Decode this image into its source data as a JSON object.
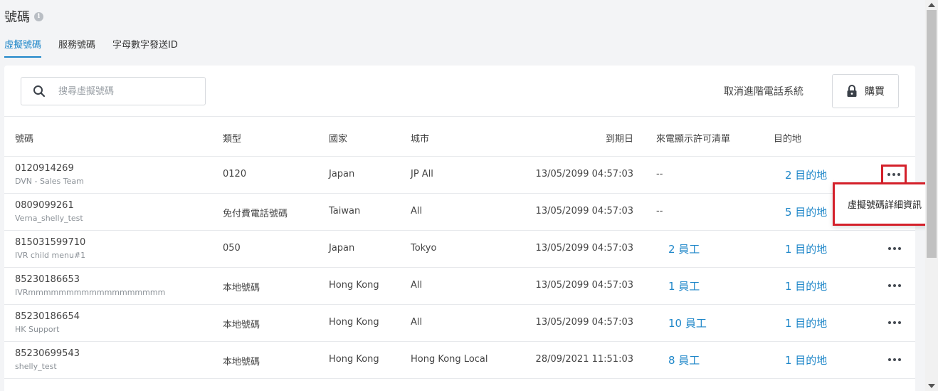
{
  "page": {
    "title": "號碼"
  },
  "tabs": [
    {
      "label": "虛擬號碼",
      "active": true
    },
    {
      "label": "服務號碼",
      "active": false
    },
    {
      "label": "字母數字發送ID",
      "active": false
    }
  ],
  "toolbar": {
    "search_placeholder": "搜尋虛擬號碼",
    "cancel_label": "取消進階電話系統",
    "buy_label": "購買"
  },
  "table": {
    "headers": {
      "number": "號碼",
      "type": "類型",
      "country": "國家",
      "city": "城市",
      "expiry": "到期日",
      "caller_id": "來電顯示許可清單",
      "destination": "目的地"
    },
    "rows": [
      {
        "number": "0120914269",
        "name": "DVN - Sales Team",
        "type": "0120",
        "country": "Japan",
        "city": "JP All",
        "expiry": "13/05/2099 04:57:03",
        "caller_id": "--",
        "destination": "2 目的地"
      },
      {
        "number": "0809099261",
        "name": "Verna_shelly_test",
        "type": "免付費電話號碼",
        "country": "Taiwan",
        "city": "All",
        "expiry": "13/05/2099 04:57:03",
        "caller_id": "--",
        "destination": "5 目的地"
      },
      {
        "number": "815031599710",
        "name": "IVR child menu#1",
        "type": "050",
        "country": "Japan",
        "city": "Tokyo",
        "expiry": "13/05/2099 04:57:03",
        "caller_id": "2 員工",
        "destination": "1 目的地"
      },
      {
        "number": "85230186653",
        "name": "IVRmmmmmmmmmmmmmmmmmm",
        "type": "本地號碼",
        "country": "Hong Kong",
        "city": "All",
        "expiry": "13/05/2099 04:57:03",
        "caller_id": "1 員工",
        "destination": "1 目的地"
      },
      {
        "number": "85230186654",
        "name": "HK Support",
        "type": "本地號碼",
        "country": "Hong Kong",
        "city": "All",
        "expiry": "13/05/2099 04:57:03",
        "caller_id": "10 員工",
        "destination": "1 目的地"
      },
      {
        "number": "85230699543",
        "name": "shelly_test",
        "type": "本地號碼",
        "country": "Hong Kong",
        "city": "Hong Kong Local",
        "expiry": "28/09/2021 11:51:03",
        "caller_id": "8 員工",
        "destination": "1 目的地"
      }
    ]
  },
  "dropdown": {
    "item": "虛擬號碼詳細資訊"
  },
  "colors": {
    "accent": "#1f87c9",
    "highlight": "#d4202a"
  }
}
